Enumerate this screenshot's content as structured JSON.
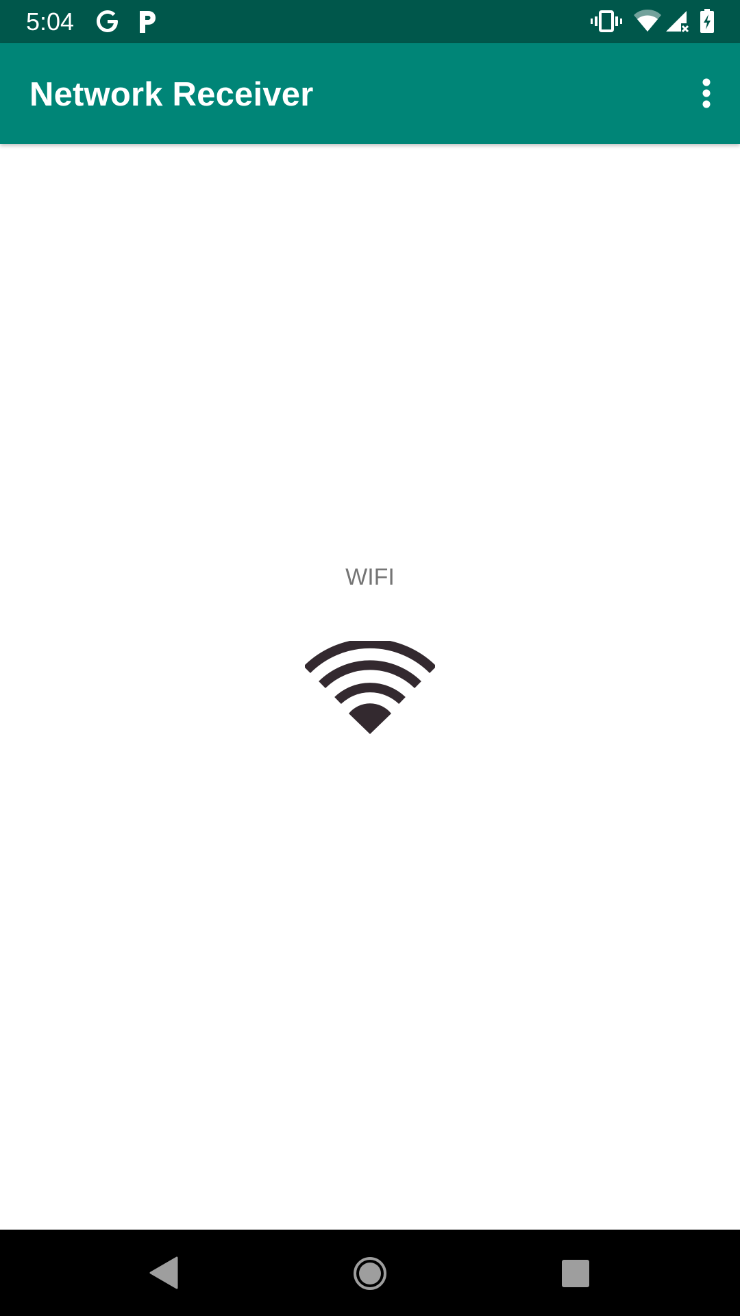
{
  "status_bar": {
    "time": "5:04",
    "left_icons": [
      "google-icon",
      "parking-icon"
    ],
    "right_icons": [
      "vibrate-icon",
      "wifi-signal-icon",
      "cell-signal-icon",
      "battery-charging-icon"
    ]
  },
  "app_bar": {
    "title": "Network Receiver",
    "overflow_icon": "more-vert-icon"
  },
  "main": {
    "network_type": "WIFI",
    "network_icon": "wifi-icon"
  },
  "nav_bar": {
    "buttons": [
      "back-icon",
      "home-icon",
      "recents-icon"
    ]
  },
  "colors": {
    "status_bar": "#00574b",
    "app_bar": "#008577",
    "label_text": "#757575",
    "icon": "#33292f"
  }
}
